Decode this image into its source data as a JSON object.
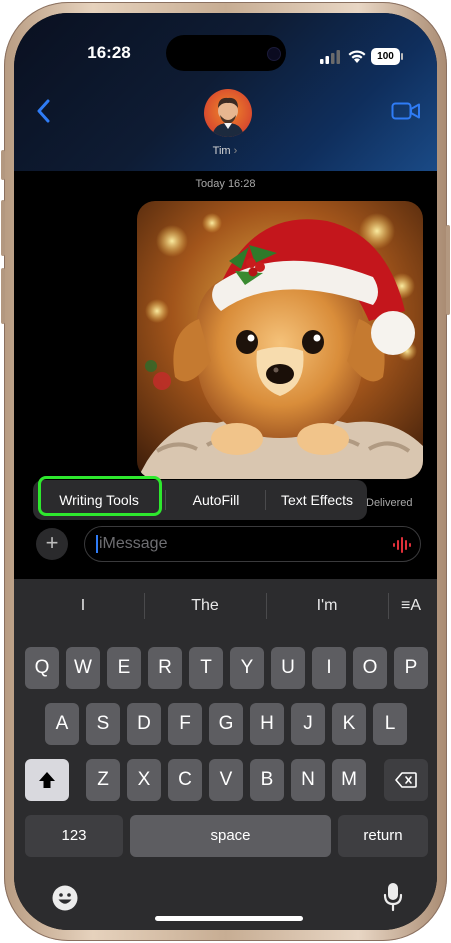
{
  "status_bar": {
    "time": "16:28",
    "battery": "100"
  },
  "header": {
    "back_icon": "chevron-left-icon",
    "contact_name": "Tim",
    "video_icon": "video-camera-icon"
  },
  "thread": {
    "timestamp": "Today 16:28",
    "delivered": "Delivered"
  },
  "popup_menu": {
    "items": [
      "Writing Tools",
      "AutoFill",
      "Text Effects"
    ]
  },
  "compose": {
    "placeholder": "iMessage"
  },
  "keyboard": {
    "suggestions": [
      "I",
      "The",
      "I'm"
    ],
    "format_icon": "≡A",
    "row1": [
      "Q",
      "W",
      "E",
      "R",
      "T",
      "Y",
      "U",
      "I",
      "O",
      "P"
    ],
    "row2": [
      "A",
      "S",
      "D",
      "F",
      "G",
      "H",
      "J",
      "K",
      "L"
    ],
    "row3": [
      "Z",
      "X",
      "C",
      "V",
      "B",
      "N",
      "M"
    ],
    "numbers_label": "123",
    "space_label": "space",
    "return_label": "return"
  },
  "colors": {
    "highlight": "#2ee82e",
    "accent_blue": "#2f7cf6",
    "mic_red": "#e0303a"
  }
}
